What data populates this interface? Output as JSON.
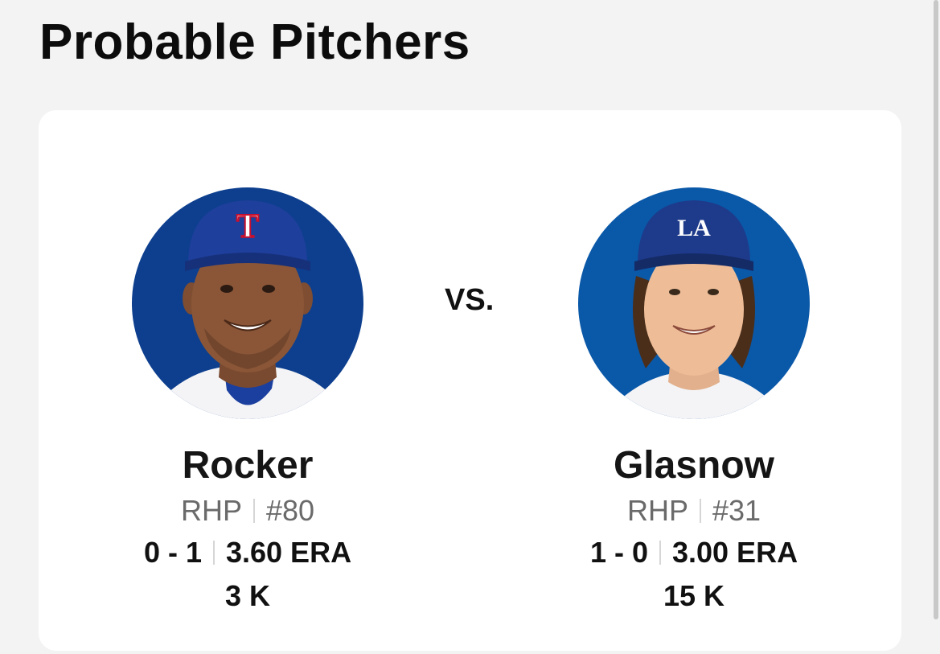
{
  "header": {
    "title": "Probable Pitchers"
  },
  "matchup": {
    "vs_label": "VS."
  },
  "away_pitcher": {
    "name": "Rocker",
    "throws": "RHP",
    "number": "#80",
    "record": "0 - 1",
    "era": "3.60 ERA",
    "strikeouts": "3 K",
    "photo": "player-headshot-rangers",
    "cap_logo": "T",
    "cap_color": "#1f3f9c",
    "background_color": "#0d3f8e"
  },
  "home_pitcher": {
    "name": "Glasnow",
    "throws": "RHP",
    "number": "#31",
    "record": "1 - 0",
    "era": "3.00 ERA",
    "strikeouts": "15 K",
    "photo": "player-headshot-dodgers",
    "cap_logo": "LA",
    "cap_color": "#1e3a8a",
    "background_color": "#0a58a8"
  }
}
